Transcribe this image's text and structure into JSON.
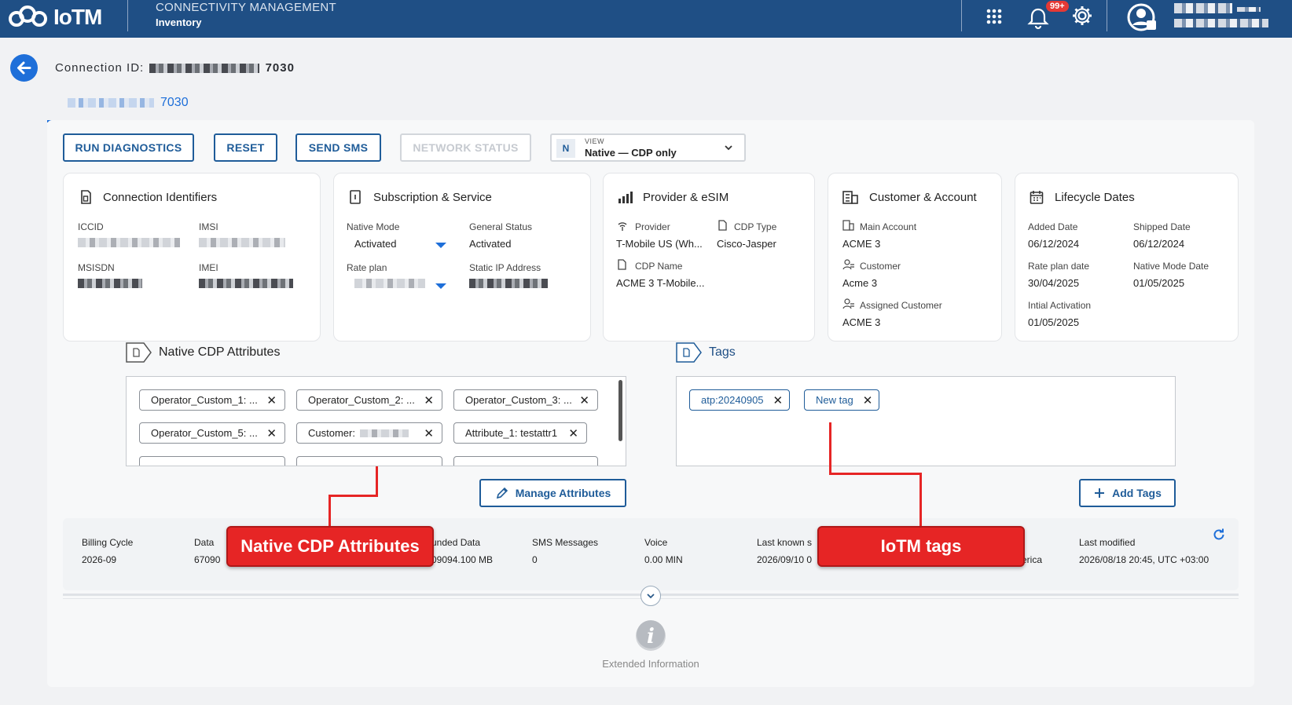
{
  "header": {
    "logo_text": "IoTM",
    "section_title": "CONNECTIVITY MANAGEMENT",
    "section_sub": "Inventory",
    "notification_badge": "99+"
  },
  "connection": {
    "label": "Connection ID:",
    "id_suffix": "7030",
    "tab_suffix": "7030"
  },
  "toolbar": {
    "run_diagnostics": "RUN DIAGNOSTICS",
    "reset": "RESET",
    "send_sms": "SEND SMS",
    "network_status": "NETWORK STATUS",
    "view_badge": "N",
    "view_label": "VIEW",
    "view_value": "Native — CDP only"
  },
  "cards": {
    "identifiers": {
      "title": "Connection Identifiers",
      "iccid": "ICCID",
      "imsi": "IMSI",
      "msisdn": "MSISDN",
      "imei": "IMEI"
    },
    "subscription": {
      "title": "Subscription & Service",
      "native_mode_label": "Native Mode",
      "native_mode_value": "Activated",
      "general_status_label": "General Status",
      "general_status_value": "Activated",
      "rate_plan_label": "Rate plan",
      "static_ip_label": "Static IP Address"
    },
    "provider": {
      "title": "Provider & eSIM",
      "provider_label": "Provider",
      "provider_value": "T-Mobile US (Wh...",
      "cdp_type_label": "CDP Type",
      "cdp_type_value": "Cisco-Jasper",
      "cdp_name_label": "CDP Name",
      "cdp_name_value": "ACME 3 T-Mobile..."
    },
    "customer": {
      "title": "Customer & Account",
      "main_account_label": "Main Account",
      "main_account_value": "ACME 3",
      "customer_label": "Customer",
      "customer_value": "Acme 3",
      "assigned_label": "Assigned Customer",
      "assigned_value": "ACME 3"
    },
    "lifecycle": {
      "title": "Lifecycle Dates",
      "added_label": "Added Date",
      "added_value": "06/12/2024",
      "shipped_label": "Shipped Date",
      "shipped_value": "06/12/2024",
      "rateplan_date_label": "Rate plan date",
      "rateplan_date_value": "30/04/2025",
      "native_mode_date_label": "Native Mode Date",
      "native_mode_date_value": "01/05/2025",
      "initial_label": "Intial Activation",
      "initial_value": "01/05/2025"
    }
  },
  "attributes": {
    "title": "Native CDP Attributes",
    "chips": [
      "Operator_Custom_1: ...",
      "Operator_Custom_2: ...",
      "Operator_Custom_3: ...",
      "Operator_Custom_5: ...",
      "Customer:",
      "Attribute_1: testattr1"
    ],
    "manage_button": "Manage Attributes"
  },
  "tags": {
    "title": "Tags",
    "items": [
      "atp:20240905",
      "New tag"
    ],
    "add_button": "Add Tags"
  },
  "status": {
    "billing_cycle_label": "Billing Cycle",
    "billing_cycle_value": "2026-09",
    "data_label": "Data",
    "data_value": "67090",
    "unded_label": "unded Data",
    "unded_value": "09094.100 MB",
    "sms_label": "SMS Messages",
    "sms_value": "0",
    "voice_label": "Voice",
    "voice_value": "0.00 MIN",
    "last_known_label": "Last known s",
    "last_known_value": "2026/09/10 0",
    "region_value": "erica",
    "last_modified_label": "Last modified",
    "last_modified_value": "2026/08/18 20:45, UTC +03:00"
  },
  "extended": {
    "label": "Extended Information"
  },
  "annotations": {
    "attributes": "Native CDP Attributes",
    "tags": "IoTM tags"
  },
  "colors": {
    "header": "#1f4f85",
    "accent": "#1e6fd9",
    "annotation": "#e62525"
  }
}
